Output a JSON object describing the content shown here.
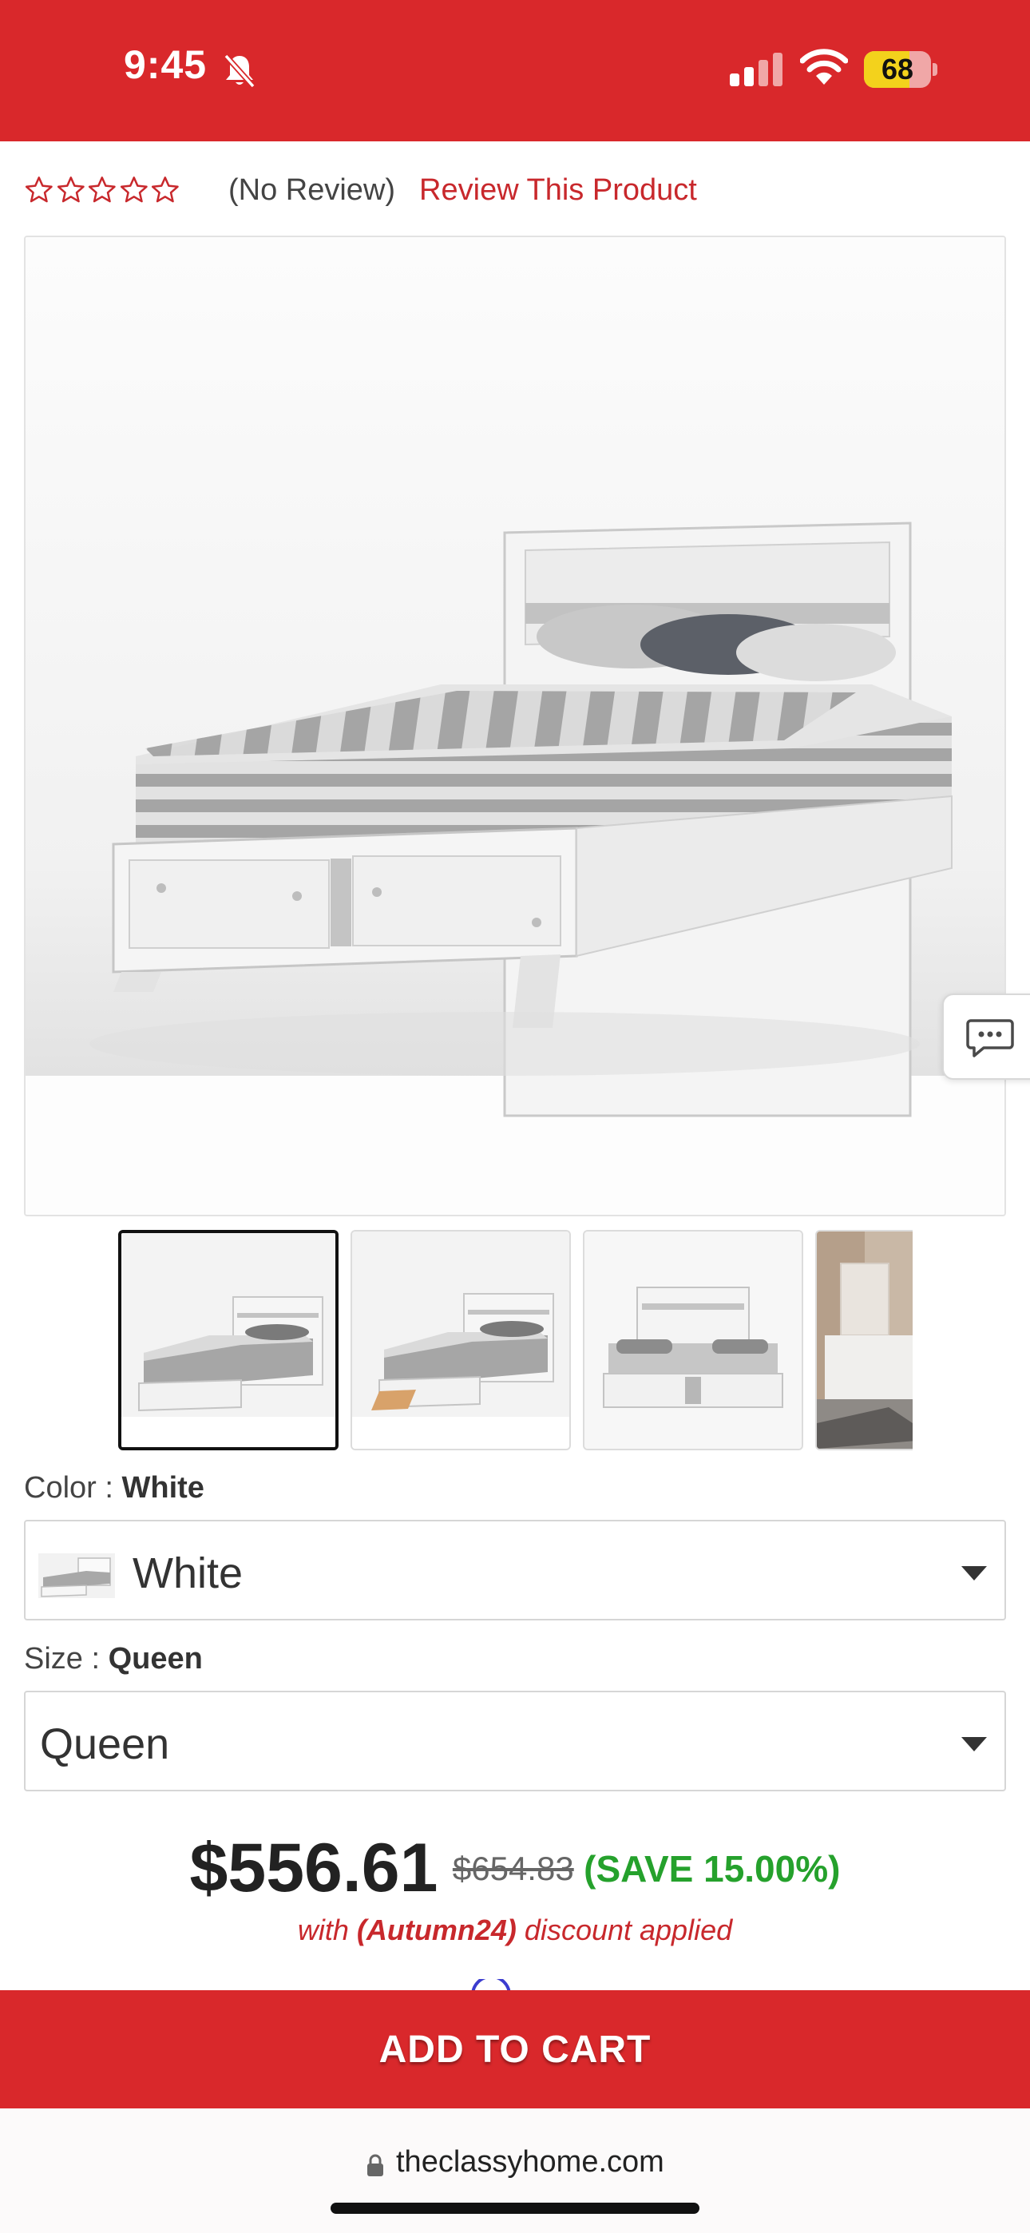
{
  "status_bar": {
    "time": "9:45",
    "battery_percent": 68,
    "battery_label": "68",
    "icons": [
      "bell-slash-icon",
      "signal-icon",
      "wifi-icon",
      "battery-icon"
    ]
  },
  "reviews": {
    "rating": 0,
    "max_rating": 5,
    "count_text": "(No Review)",
    "review_link": "Review This Product"
  },
  "product": {
    "main_image": "white-storage-bed",
    "thumbnails": [
      {
        "image": "bed-angle-view",
        "selected": true
      },
      {
        "image": "bed-drawer-open",
        "selected": false
      },
      {
        "image": "bed-front-view",
        "selected": false
      },
      {
        "image": "bedroom-room-scene",
        "selected": false
      }
    ]
  },
  "options": {
    "color_label": "Color :",
    "color_value": "White",
    "color_selected": "White",
    "size_label": "Size :",
    "size_value": "Queen",
    "size_selected": "Queen"
  },
  "pricing": {
    "price": "$556.61",
    "original_price": "$654.83",
    "savings": "(SAVE 15.00%)",
    "discount_prefix": "with",
    "discount_code": "(Autumn24)",
    "discount_suffix": "discount applied"
  },
  "cart": {
    "label": "ADD TO CART"
  },
  "browser": {
    "url": "theclassyhome.com"
  },
  "colors": {
    "brand_red": "#d9282b",
    "savings_green": "#25a12c",
    "link_red": "#c8282c"
  }
}
